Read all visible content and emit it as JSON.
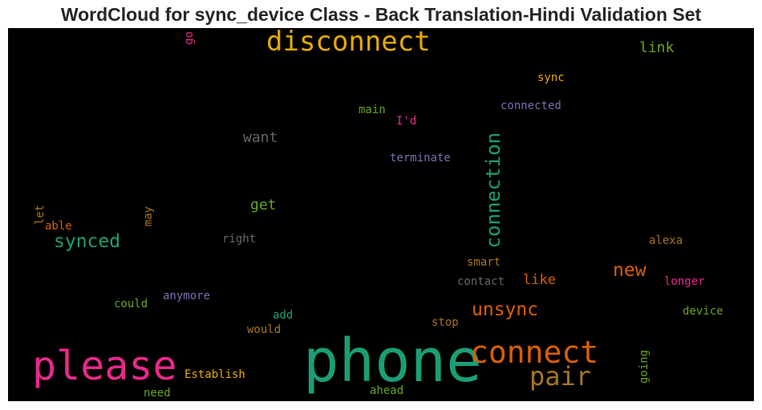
{
  "chart_data": {
    "type": "wordcloud",
    "title": "WordCloud for sync_device Class - Back Translation-Hindi Validation Set",
    "background": "#000000",
    "words": [
      {
        "text": "phone",
        "color": "#1b9e77"
      },
      {
        "text": "please",
        "color": "#e7298a"
      },
      {
        "text": "connect",
        "color": "#d95f02"
      },
      {
        "text": "disconnect",
        "color": "#e6ab02"
      },
      {
        "text": "pair",
        "color": "#a6761d"
      },
      {
        "text": "connection",
        "color": "#1b9e77",
        "vertical": true
      },
      {
        "text": "synced",
        "color": "#1b9e77"
      },
      {
        "text": "unsync",
        "color": "#d95f02"
      },
      {
        "text": "new",
        "color": "#d95f02"
      },
      {
        "text": "want",
        "color": "#666666"
      },
      {
        "text": "link",
        "color": "#66a61e"
      },
      {
        "text": "get",
        "color": "#66a61e"
      },
      {
        "text": "like",
        "color": "#d95f02"
      },
      {
        "text": "Establish",
        "color": "#e6ab02"
      },
      {
        "text": "sync",
        "color": "#e6ab02"
      },
      {
        "text": "connected",
        "color": "#7570b3"
      },
      {
        "text": "terminate",
        "color": "#7570b3"
      },
      {
        "text": "main",
        "color": "#66a61e"
      },
      {
        "text": "I'd",
        "color": "#e7298a"
      },
      {
        "text": "go",
        "color": "#e7298a",
        "vertical": true
      },
      {
        "text": "let",
        "color": "#a6761d",
        "vertical": true
      },
      {
        "text": "able",
        "color": "#d95f02"
      },
      {
        "text": "may",
        "color": "#a6761d",
        "vertical": true
      },
      {
        "text": "right",
        "color": "#666666"
      },
      {
        "text": "alexa",
        "color": "#a6761d"
      },
      {
        "text": "smart",
        "color": "#a6761d"
      },
      {
        "text": "contact",
        "color": "#666666"
      },
      {
        "text": "longer",
        "color": "#e7298a"
      },
      {
        "text": "anymore",
        "color": "#7570b3"
      },
      {
        "text": "could",
        "color": "#66a61e"
      },
      {
        "text": "add",
        "color": "#1b9e77"
      },
      {
        "text": "would",
        "color": "#a6761d"
      },
      {
        "text": "stop",
        "color": "#a6761d"
      },
      {
        "text": "device",
        "color": "#66a61e"
      },
      {
        "text": "going",
        "color": "#66a61e",
        "vertical": true
      },
      {
        "text": "need",
        "color": "#66a61e"
      },
      {
        "text": "ahead",
        "color": "#66a61e"
      }
    ]
  }
}
